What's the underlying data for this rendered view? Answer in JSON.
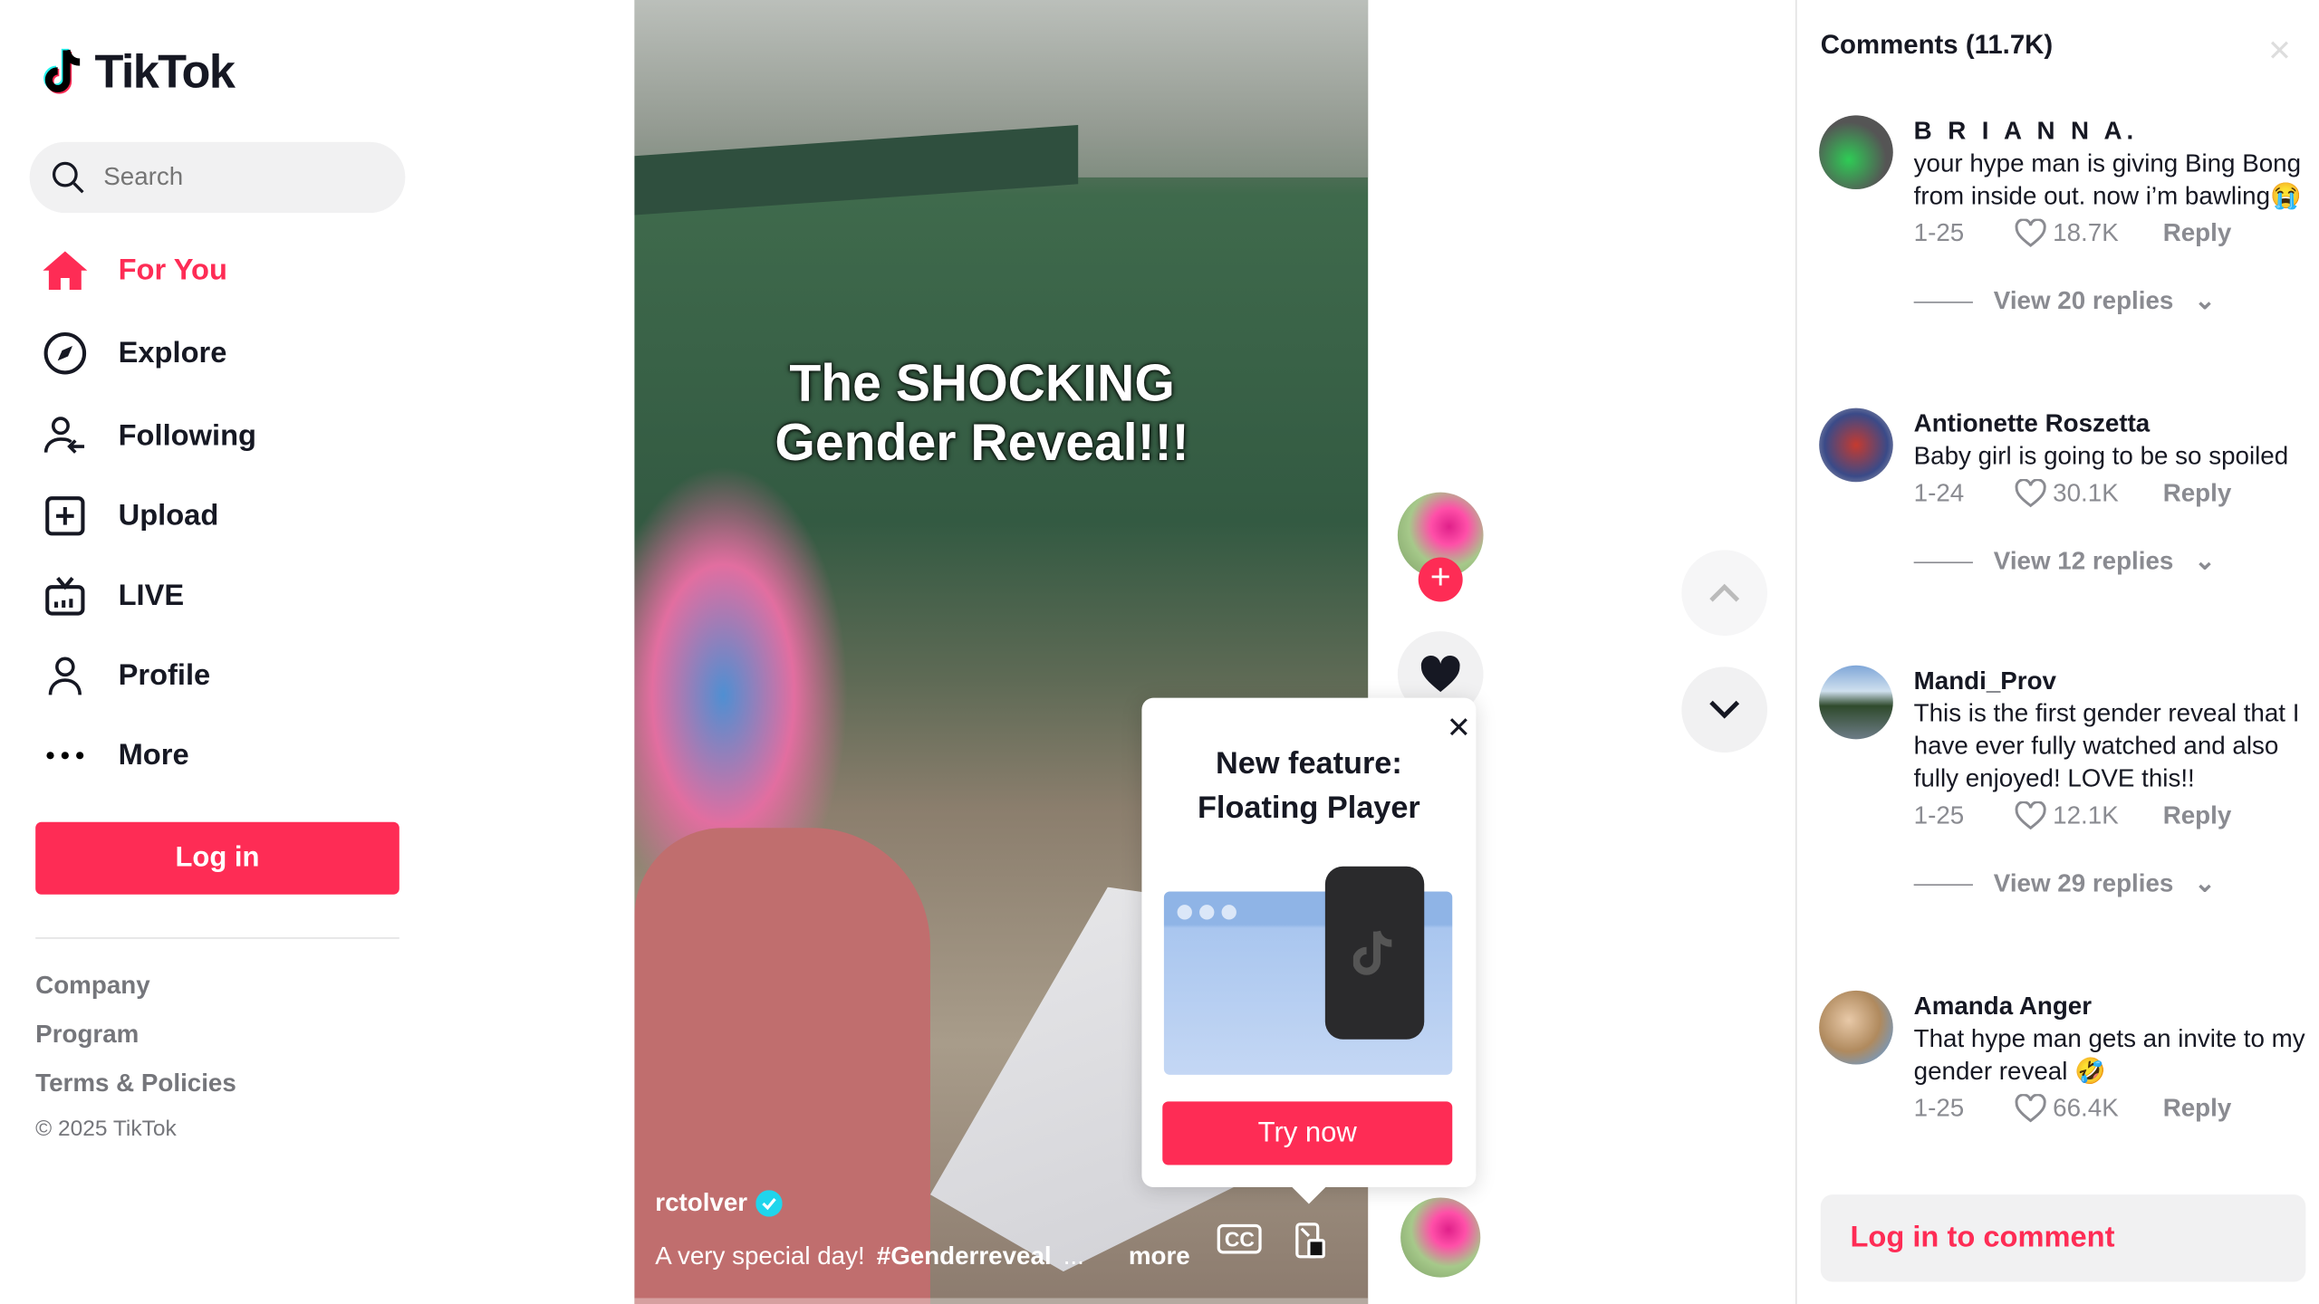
{
  "brand": {
    "name": "TikTok",
    "accent": "#fe2c55"
  },
  "search": {
    "placeholder": "Search"
  },
  "sidebar": {
    "items": [
      {
        "label": "For You",
        "icon": "home-icon",
        "active": true
      },
      {
        "label": "Explore",
        "icon": "compass-icon"
      },
      {
        "label": "Following",
        "icon": "following-icon"
      },
      {
        "label": "Upload",
        "icon": "upload-icon"
      },
      {
        "label": "LIVE",
        "icon": "live-tv-icon"
      },
      {
        "label": "Profile",
        "icon": "profile-icon"
      },
      {
        "label": "More",
        "icon": "more-dots-icon"
      }
    ],
    "login_label": "Log in",
    "footer": [
      "Company",
      "Program",
      "Terms & Policies"
    ],
    "copyright": "© 2025 TikTok"
  },
  "video": {
    "overlay_title_1": "The SHOCKING",
    "overlay_title_2": "Gender Reveal!!!",
    "author": "rctolver",
    "verified": true,
    "caption": "A very special day!",
    "hashtag": "#Genderreveal",
    "ellipsis": "...",
    "more_label": "more",
    "cc_label": "CC"
  },
  "popup": {
    "title_1": "New feature:",
    "title_2": "Floating Player",
    "button": "Try now"
  },
  "comments": {
    "title": "Comments (11.7K)",
    "login_label": "Log in to comment",
    "items": [
      {
        "name": "B R I A N N A.",
        "text": "your hype man is giving Bing Bong from inside out. now i’m bawling😭",
        "date": "1-25",
        "likes": "18.7K",
        "reply": "Reply",
        "view_replies": "View 20 replies"
      },
      {
        "name": "Antionette Roszetta",
        "text": "Baby girl is going to be so spoiled",
        "date": "1-24",
        "likes": "30.1K",
        "reply": "Reply",
        "view_replies": "View 12 replies"
      },
      {
        "name": "Mandi_Prov",
        "text": "This is the first gender reveal that I have ever fully watched and also fully enjoyed! LOVE this!!",
        "date": "1-25",
        "likes": "12.1K",
        "reply": "Reply",
        "view_replies": "View 29 replies"
      },
      {
        "name": "Amanda Anger",
        "text": "That hype man gets an invite to my gender reveal 🤣",
        "date": "1-25",
        "likes": "66.4K",
        "reply": "Reply"
      }
    ]
  }
}
